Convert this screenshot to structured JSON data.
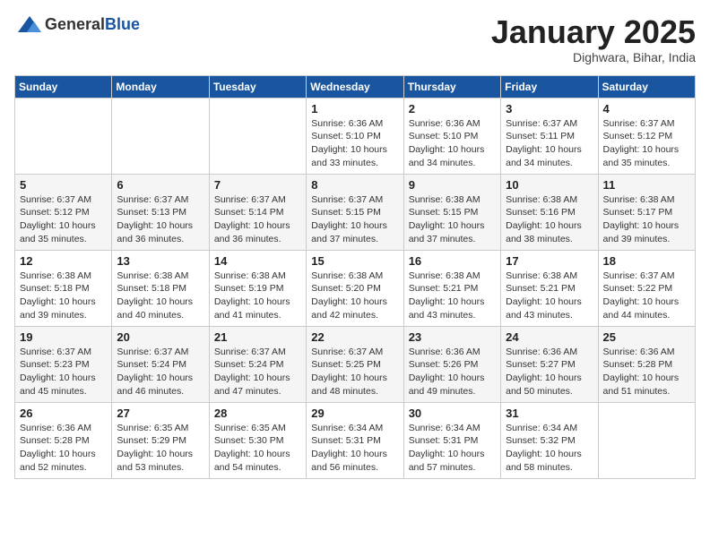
{
  "header": {
    "logo_line1": "General",
    "logo_line2": "Blue",
    "month_title": "January 2025",
    "subtitle": "Dighwara, Bihar, India"
  },
  "weekdays": [
    "Sunday",
    "Monday",
    "Tuesday",
    "Wednesday",
    "Thursday",
    "Friday",
    "Saturday"
  ],
  "weeks": [
    [
      {
        "day": "",
        "info": ""
      },
      {
        "day": "",
        "info": ""
      },
      {
        "day": "",
        "info": ""
      },
      {
        "day": "1",
        "info": "Sunrise: 6:36 AM\nSunset: 5:10 PM\nDaylight: 10 hours\nand 33 minutes."
      },
      {
        "day": "2",
        "info": "Sunrise: 6:36 AM\nSunset: 5:10 PM\nDaylight: 10 hours\nand 34 minutes."
      },
      {
        "day": "3",
        "info": "Sunrise: 6:37 AM\nSunset: 5:11 PM\nDaylight: 10 hours\nand 34 minutes."
      },
      {
        "day": "4",
        "info": "Sunrise: 6:37 AM\nSunset: 5:12 PM\nDaylight: 10 hours\nand 35 minutes."
      }
    ],
    [
      {
        "day": "5",
        "info": "Sunrise: 6:37 AM\nSunset: 5:12 PM\nDaylight: 10 hours\nand 35 minutes."
      },
      {
        "day": "6",
        "info": "Sunrise: 6:37 AM\nSunset: 5:13 PM\nDaylight: 10 hours\nand 36 minutes."
      },
      {
        "day": "7",
        "info": "Sunrise: 6:37 AM\nSunset: 5:14 PM\nDaylight: 10 hours\nand 36 minutes."
      },
      {
        "day": "8",
        "info": "Sunrise: 6:37 AM\nSunset: 5:15 PM\nDaylight: 10 hours\nand 37 minutes."
      },
      {
        "day": "9",
        "info": "Sunrise: 6:38 AM\nSunset: 5:15 PM\nDaylight: 10 hours\nand 37 minutes."
      },
      {
        "day": "10",
        "info": "Sunrise: 6:38 AM\nSunset: 5:16 PM\nDaylight: 10 hours\nand 38 minutes."
      },
      {
        "day": "11",
        "info": "Sunrise: 6:38 AM\nSunset: 5:17 PM\nDaylight: 10 hours\nand 39 minutes."
      }
    ],
    [
      {
        "day": "12",
        "info": "Sunrise: 6:38 AM\nSunset: 5:18 PM\nDaylight: 10 hours\nand 39 minutes."
      },
      {
        "day": "13",
        "info": "Sunrise: 6:38 AM\nSunset: 5:18 PM\nDaylight: 10 hours\nand 40 minutes."
      },
      {
        "day": "14",
        "info": "Sunrise: 6:38 AM\nSunset: 5:19 PM\nDaylight: 10 hours\nand 41 minutes."
      },
      {
        "day": "15",
        "info": "Sunrise: 6:38 AM\nSunset: 5:20 PM\nDaylight: 10 hours\nand 42 minutes."
      },
      {
        "day": "16",
        "info": "Sunrise: 6:38 AM\nSunset: 5:21 PM\nDaylight: 10 hours\nand 43 minutes."
      },
      {
        "day": "17",
        "info": "Sunrise: 6:38 AM\nSunset: 5:21 PM\nDaylight: 10 hours\nand 43 minutes."
      },
      {
        "day": "18",
        "info": "Sunrise: 6:37 AM\nSunset: 5:22 PM\nDaylight: 10 hours\nand 44 minutes."
      }
    ],
    [
      {
        "day": "19",
        "info": "Sunrise: 6:37 AM\nSunset: 5:23 PM\nDaylight: 10 hours\nand 45 minutes."
      },
      {
        "day": "20",
        "info": "Sunrise: 6:37 AM\nSunset: 5:24 PM\nDaylight: 10 hours\nand 46 minutes."
      },
      {
        "day": "21",
        "info": "Sunrise: 6:37 AM\nSunset: 5:24 PM\nDaylight: 10 hours\nand 47 minutes."
      },
      {
        "day": "22",
        "info": "Sunrise: 6:37 AM\nSunset: 5:25 PM\nDaylight: 10 hours\nand 48 minutes."
      },
      {
        "day": "23",
        "info": "Sunrise: 6:36 AM\nSunset: 5:26 PM\nDaylight: 10 hours\nand 49 minutes."
      },
      {
        "day": "24",
        "info": "Sunrise: 6:36 AM\nSunset: 5:27 PM\nDaylight: 10 hours\nand 50 minutes."
      },
      {
        "day": "25",
        "info": "Sunrise: 6:36 AM\nSunset: 5:28 PM\nDaylight: 10 hours\nand 51 minutes."
      }
    ],
    [
      {
        "day": "26",
        "info": "Sunrise: 6:36 AM\nSunset: 5:28 PM\nDaylight: 10 hours\nand 52 minutes."
      },
      {
        "day": "27",
        "info": "Sunrise: 6:35 AM\nSunset: 5:29 PM\nDaylight: 10 hours\nand 53 minutes."
      },
      {
        "day": "28",
        "info": "Sunrise: 6:35 AM\nSunset: 5:30 PM\nDaylight: 10 hours\nand 54 minutes."
      },
      {
        "day": "29",
        "info": "Sunrise: 6:34 AM\nSunset: 5:31 PM\nDaylight: 10 hours\nand 56 minutes."
      },
      {
        "day": "30",
        "info": "Sunrise: 6:34 AM\nSunset: 5:31 PM\nDaylight: 10 hours\nand 57 minutes."
      },
      {
        "day": "31",
        "info": "Sunrise: 6:34 AM\nSunset: 5:32 PM\nDaylight: 10 hours\nand 58 minutes."
      },
      {
        "day": "",
        "info": ""
      }
    ]
  ]
}
